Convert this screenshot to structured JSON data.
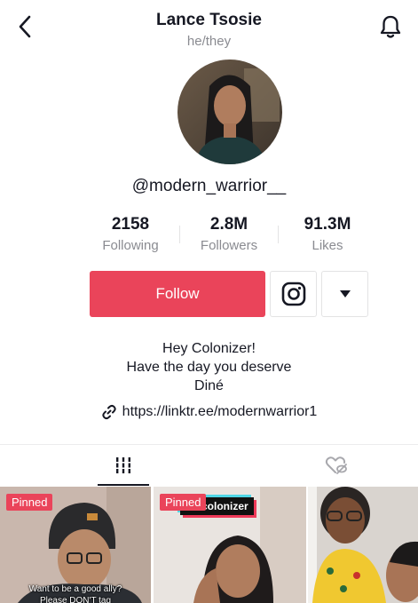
{
  "header": {
    "name": "Lance Tsosie",
    "pronouns": "he/they",
    "back_icon": "chevron-left-icon",
    "bell_icon": "bell-icon"
  },
  "profile": {
    "username": "@modern_warrior__"
  },
  "stats": [
    {
      "value": "2158",
      "label": "Following"
    },
    {
      "value": "2.8M",
      "label": "Followers"
    },
    {
      "value": "91.3M",
      "label": "Likes"
    }
  ],
  "actions": {
    "follow_label": "Follow",
    "instagram_icon": "instagram-icon",
    "dropdown_icon": "triangle-down-icon"
  },
  "bio": {
    "line1": "Hey Colonizer!",
    "line2": "Have the day you deserve",
    "line3": "Diné",
    "link": "https://linktr.ee/modernwarrior1"
  },
  "tabs": {
    "videos_icon": "grid-icon",
    "liked_icon": "hidden-heart-icon"
  },
  "videos": [
    {
      "badge": "Pinned",
      "caption_line1": "Want to be a good ally?",
      "caption_line2": "Please DON'T tag"
    },
    {
      "badge": "Pinned",
      "overlay": "de-colonizer"
    },
    {}
  ],
  "colors": {
    "accent": "#ea445a",
    "text_primary": "#161823",
    "text_secondary": "#8a8b91"
  }
}
